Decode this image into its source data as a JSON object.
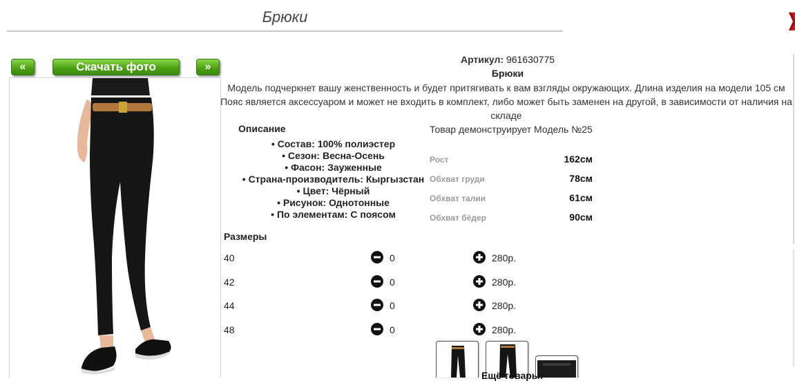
{
  "page": {
    "title": "Брюки"
  },
  "nav": {
    "prev_label": "«",
    "download_label": "Скачать фото",
    "next_label": "»"
  },
  "product": {
    "artikul_label": "Артикул:",
    "artikul_value": "961630775",
    "name": "Брюки",
    "description": "Модель подчеркнет вашу женственность и будет притягивать к вам взгляды окружающих. Длина изделия на модели 105 см Пояс является аксессуаром и может не входить в комплект, либо может быть заменен на другой, в зависимости от наличия на складе"
  },
  "specs": {
    "heading": "Описание",
    "items": [
      "Состав: 100% полиэстер",
      "Сезон: Весна-Осень",
      "Фасон: Зауженные",
      "Страна-производитель: Кыргызстан",
      "Цвет: Чёрный",
      "Рисунок: Однотонные",
      "По элементам: С поясом"
    ]
  },
  "model": {
    "heading": "Товар демонструирует Модель №25",
    "measurements": [
      {
        "label": "Рост",
        "value": "162см"
      },
      {
        "label": "Обхват груди",
        "value": "78см"
      },
      {
        "label": "Обхват талии",
        "value": "61см"
      },
      {
        "label": "Обхват бёдер",
        "value": "90см"
      }
    ]
  },
  "sizes": {
    "heading": "Размеры",
    "rows": [
      {
        "size": "40",
        "qty": "0",
        "price": "280р."
      },
      {
        "size": "42",
        "qty": "0",
        "price": "280р."
      },
      {
        "size": "44",
        "qty": "0",
        "price": "280р."
      },
      {
        "size": "48",
        "qty": "0",
        "price": "280р."
      }
    ]
  },
  "more": {
    "label": "Ещё товары:"
  },
  "icons": {
    "close": "close-icon",
    "minus": "minus-circle-icon",
    "plus": "plus-circle-icon"
  },
  "colors": {
    "button_green": "#4ea315",
    "close_red": "#e0141a"
  }
}
